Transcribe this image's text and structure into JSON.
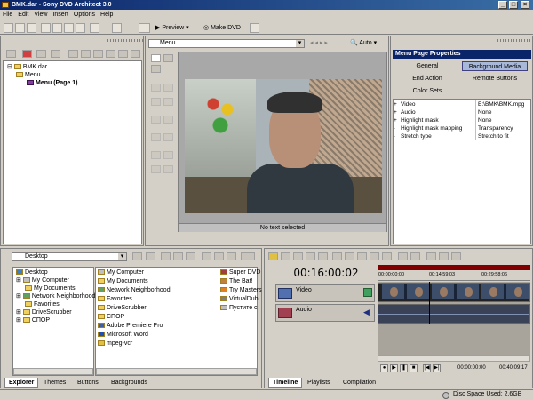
{
  "window": {
    "title": "BMK.dar - Sony DVD Architect 3.0"
  },
  "menu": [
    "File",
    "Edit",
    "View",
    "Insert",
    "Options",
    "Help"
  ],
  "toolbar": {
    "preview_label": "Preview",
    "make_dvd_label": "Make DVD"
  },
  "project_tree": {
    "root": "BMK.dar",
    "menu": "Menu",
    "page": "Menu (Page 1)"
  },
  "workspace": {
    "menu_select": "Menu",
    "zoom": "Auto",
    "status": "No text selected"
  },
  "properties": {
    "title": "Menu Page Properties",
    "tabs": [
      "General",
      "Background Media",
      "End Action",
      "Remote Buttons",
      "Color Sets"
    ],
    "rows": [
      {
        "key": "Video",
        "value": "E:\\BMK\\BMK.mpg"
      },
      {
        "key": "Audio",
        "value": "None"
      },
      {
        "key": "Highlight mask",
        "value": "None"
      },
      {
        "key": "Highlight mask mapping",
        "value": "Transparency"
      },
      {
        "key": "Stretch type",
        "value": "Stretch to fit"
      }
    ]
  },
  "explorer": {
    "path": "Desktop",
    "tree": [
      "Desktop",
      "My Computer",
      "My Documents",
      "Network Neighborhood",
      "Favorites",
      "DriveScrubber",
      "СПОР"
    ],
    "list_col1": [
      "My Computer",
      "My Documents",
      "Network Neighborhood",
      "Favorites",
      "DriveScrubber",
      "СПОР",
      "Adobe Premiere Pro",
      "Microsoft Word",
      "mpeg-vcr"
    ],
    "list_col2": [
      "Super DVD",
      "The Bat!",
      "Try Masters",
      "VirtualDub",
      "Пустите с"
    ],
    "tabs": [
      "Explorer",
      "Themes",
      "Buttons",
      "Backgrounds"
    ]
  },
  "timeline": {
    "timecode": "00:16:00:02",
    "ruler": [
      "00:00:00:00",
      "00:14:59:03",
      "00:29:58:06"
    ],
    "tracks": [
      "Video",
      "Audio"
    ],
    "transport_start": "00:00:00:00",
    "transport_end": "00:40:09:17",
    "tabs": [
      "Timeline",
      "Playlists",
      "Compilation"
    ]
  },
  "status": {
    "disc_space": "Disc Space Used: 2,6GB"
  }
}
